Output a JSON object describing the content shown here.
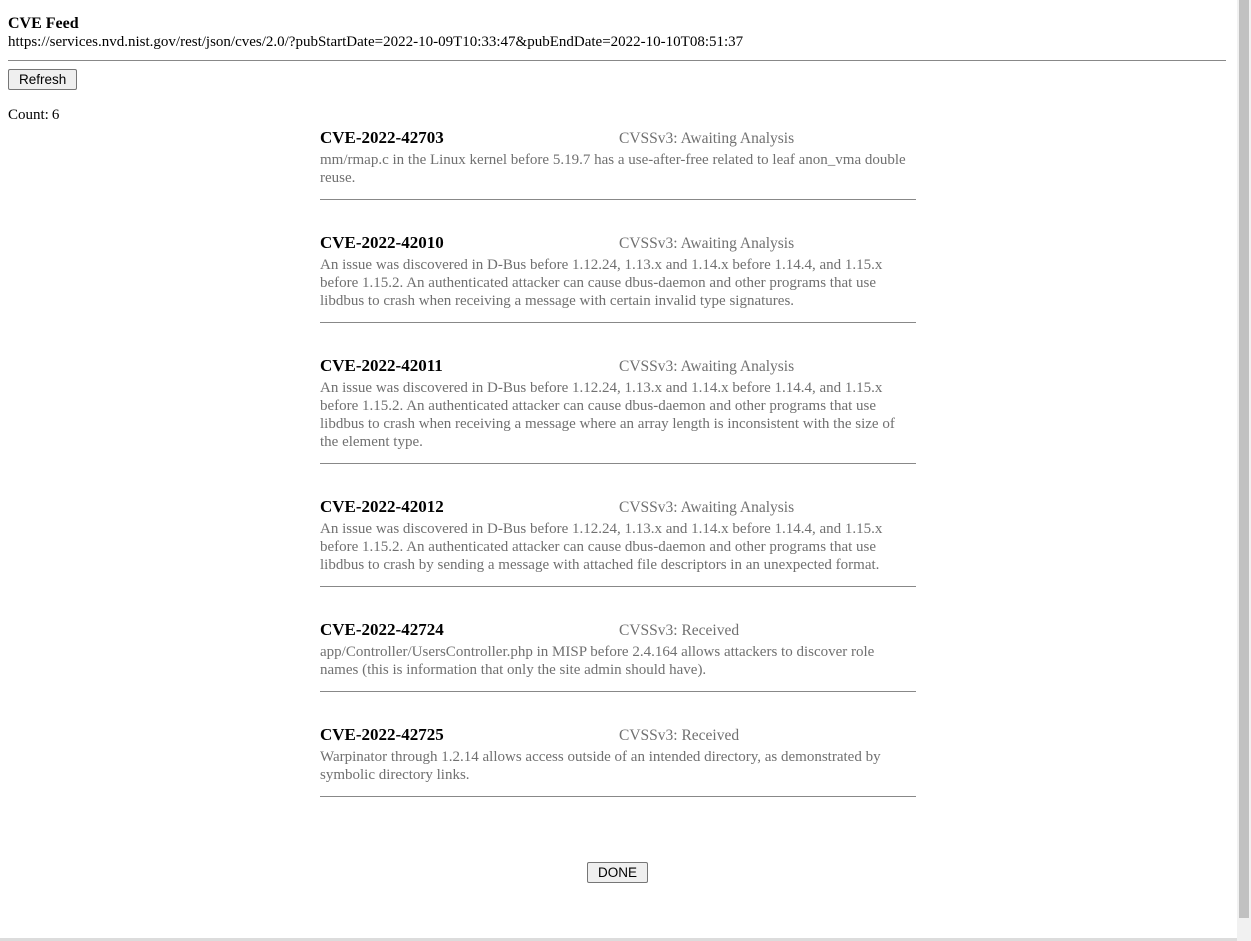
{
  "header": {
    "title": "CVE Feed",
    "url": "https://services.nvd.nist.gov/rest/json/cves/2.0/?pubStartDate=2022-10-09T10:33:47&pubEndDate=2022-10-10T08:51:37"
  },
  "refresh_label": "Refresh",
  "count": {
    "label": "Count:",
    "value": "6"
  },
  "cves": [
    {
      "id": "CVE-2022-42703",
      "cvss": "CVSSv3: Awaiting Analysis",
      "description": "mm/rmap.c in the Linux kernel before 5.19.7 has a use-after-free related to leaf anon_vma double reuse."
    },
    {
      "id": "CVE-2022-42010",
      "cvss": "CVSSv3: Awaiting Analysis",
      "description": "An issue was discovered in D-Bus before 1.12.24, 1.13.x and 1.14.x before 1.14.4, and 1.15.x before 1.15.2. An authenticated attacker can cause dbus-daemon and other programs that use libdbus to crash when receiving a message with certain invalid type signatures."
    },
    {
      "id": "CVE-2022-42011",
      "cvss": "CVSSv3: Awaiting Analysis",
      "description": "An issue was discovered in D-Bus before 1.12.24, 1.13.x and 1.14.x before 1.14.4, and 1.15.x before 1.15.2. An authenticated attacker can cause dbus-daemon and other programs that use libdbus to crash when receiving a message where an array length is inconsistent with the size of the element type."
    },
    {
      "id": "CVE-2022-42012",
      "cvss": "CVSSv3: Awaiting Analysis",
      "description": "An issue was discovered in D-Bus before 1.12.24, 1.13.x and 1.14.x before 1.14.4, and 1.15.x before 1.15.2. An authenticated attacker can cause dbus-daemon and other programs that use libdbus to crash by sending a message with attached file descriptors in an unexpected format."
    },
    {
      "id": "CVE-2022-42724",
      "cvss": "CVSSv3: Received",
      "description": "app/Controller/UsersController.php in MISP before 2.4.164 allows attackers to discover role names (this is information that only the site admin should have)."
    },
    {
      "id": "CVE-2022-42725",
      "cvss": "CVSSv3: Received",
      "description": "Warpinator through 1.2.14 allows access outside of an intended directory, as demonstrated by symbolic directory links."
    }
  ],
  "done_label": "DONE"
}
